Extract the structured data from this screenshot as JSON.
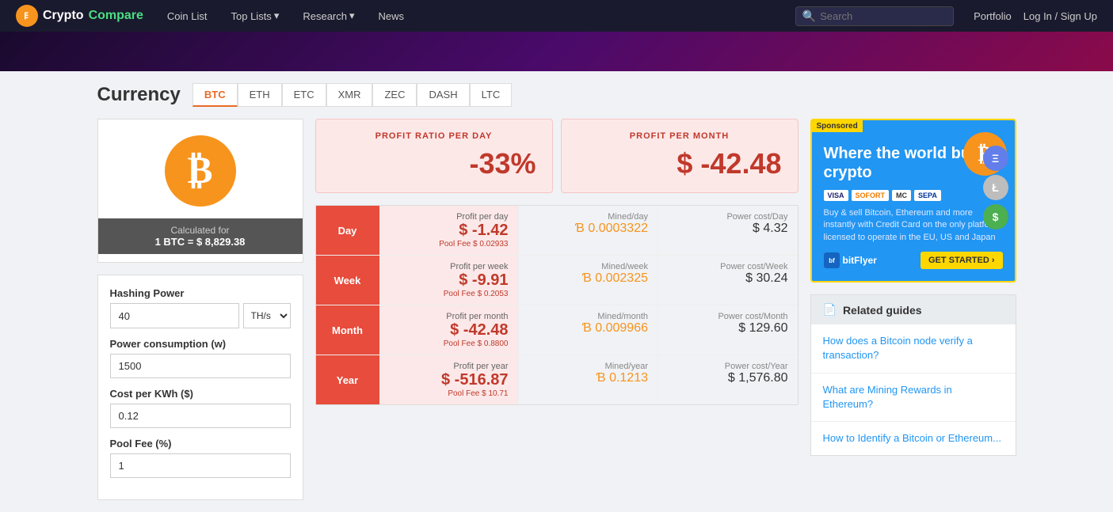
{
  "navbar": {
    "brand": "CryptoCompare",
    "brand_crypto": "Crypto",
    "brand_compare": "Compare",
    "nav_items": [
      {
        "label": "Coin List",
        "id": "coin-list"
      },
      {
        "label": "Top Lists",
        "id": "top-lists",
        "has_dropdown": true
      },
      {
        "label": "Research",
        "id": "research",
        "has_dropdown": true
      },
      {
        "label": "News",
        "id": "news"
      }
    ],
    "search_placeholder": "Search",
    "portfolio_label": "Portfolio",
    "login_label": "Log In / Sign Up"
  },
  "currency_tabs": {
    "items": [
      {
        "label": "BTC",
        "active": true
      },
      {
        "label": "ETH",
        "active": false
      },
      {
        "label": "ETC",
        "active": false
      },
      {
        "label": "XMR",
        "active": false
      },
      {
        "label": "ZEC",
        "active": false
      },
      {
        "label": "DASH",
        "active": false
      },
      {
        "label": "LTC",
        "active": false
      }
    ]
  },
  "page": {
    "title": "Currency"
  },
  "coin": {
    "symbol": "₿",
    "calculated_label": "Calculated for",
    "btc_value": "1 BTC = $ 8,829.38"
  },
  "form": {
    "hashing_power_label": "Hashing Power",
    "hashing_power_value": "40",
    "hashing_unit": "TH/s",
    "power_consumption_label": "Power consumption (w)",
    "power_consumption_value": "1500",
    "cost_per_kwh_label": "Cost per KWh ($)",
    "cost_per_kwh_value": "0.12",
    "pool_fee_label": "Pool Fee (%)",
    "pool_fee_value": "1"
  },
  "profit_summary": {
    "ratio_label": "PROFIT RATIO PER DAY",
    "ratio_value": "-33%",
    "month_label": "PROFIT PER MONTH",
    "month_value": "$ -42.48"
  },
  "mining_rows": [
    {
      "period": "Day",
      "profit_label": "Profit per day",
      "profit_value": "$ -1.42",
      "pool_fee": "Pool Fee $ 0.02933",
      "mined_label": "Mined/day",
      "mined_value": "Ɓ 0.0003322",
      "power_label": "Power cost/Day",
      "power_value": "$ 4.32"
    },
    {
      "period": "Week",
      "profit_label": "Profit per week",
      "profit_value": "$ -9.91",
      "pool_fee": "Pool Fee $ 0.2053",
      "mined_label": "Mined/week",
      "mined_value": "Ɓ 0.002325",
      "power_label": "Power cost/Week",
      "power_value": "$ 30.24"
    },
    {
      "period": "Month",
      "profit_label": "Profit per month",
      "profit_value": "$ -42.48",
      "pool_fee": "Pool Fee $ 0.8800",
      "mined_label": "Mined/month",
      "mined_value": "Ɓ 0.009966",
      "power_label": "Power cost/Month",
      "power_value": "$ 129.60"
    },
    {
      "period": "Year",
      "profit_label": "Profit per year",
      "profit_value": "$ -516.87",
      "pool_fee": "Pool Fee $ 10.71",
      "mined_label": "Mined/year",
      "mined_value": "Ɓ 0.1213",
      "power_label": "Power cost/Year",
      "power_value": "$ 1,576.80"
    }
  ],
  "ad": {
    "sponsored": "Sponsored",
    "title": "Where the world buys crypto",
    "desc": "Buy & sell Bitcoin, Ethereum and more instantly with Credit Card on the only platform licensed to operate in the EU, US and Japan",
    "payment_logos": [
      "VISA",
      "SOFORT",
      "MC",
      "SEPA"
    ],
    "bitflyer": "bitFlyer",
    "get_started": "GET STARTED ›"
  },
  "related_guides": {
    "title": "Related guides",
    "items": [
      "How does a Bitcoin node verify a transaction?",
      "What are Mining Rewards in Ethereum?",
      "How to Identify a Bitcoin or Ethereum..."
    ]
  }
}
